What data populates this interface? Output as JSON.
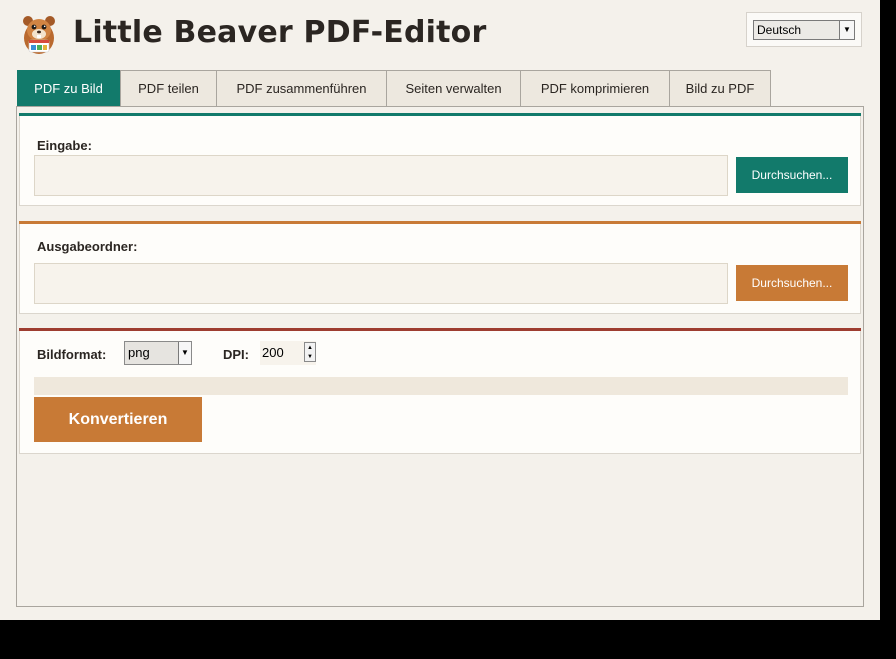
{
  "window": {
    "app_title": "Little Beaver PDF-Editor",
    "logo_icon": "beaver-mascot-icon"
  },
  "language": {
    "selected": "Deutsch"
  },
  "tabs": [
    {
      "label": "PDF zu Bild",
      "active": true
    },
    {
      "label": "PDF teilen",
      "active": false
    },
    {
      "label": "PDF zusammenführen",
      "active": false
    },
    {
      "label": "Seiten verwalten",
      "active": false
    },
    {
      "label": "PDF komprimieren",
      "active": false
    },
    {
      "label": "Bild zu PDF",
      "active": false
    }
  ],
  "input_section": {
    "label": "Eingabe:",
    "value": "",
    "browse_label": "Durchsuchen...",
    "accent": "#127a6b"
  },
  "output_section": {
    "label": "Ausgabeordner:",
    "value": "",
    "browse_label": "Durchsuchen...",
    "accent": "#c87a36"
  },
  "options_section": {
    "format_label": "Bildformat:",
    "format_value": "png",
    "dpi_label": "DPI:",
    "dpi_value": "200",
    "progress": 0,
    "convert_label": "Konvertieren",
    "accent": "#9e3d30"
  },
  "colors": {
    "primary_teal": "#127a6b",
    "accent_orange": "#c87a36",
    "accent_red": "#9e3d30",
    "background": "#f4f1eb"
  }
}
